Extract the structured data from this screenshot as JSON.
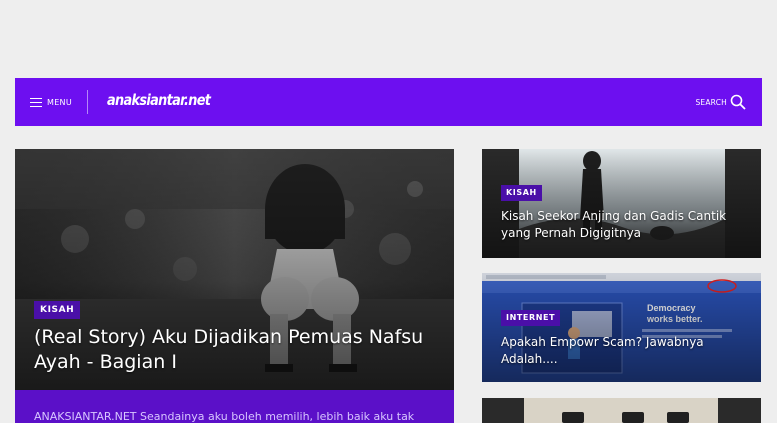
{
  "header": {
    "menu_label": "MENU",
    "logo_text": "anaksiantar.net",
    "search_label": "SEARCH"
  },
  "featured": {
    "tag": "KISAH",
    "title": "(Real Story) Aku Dijadikan Pemuas Nafsu Ayah - Bagian I",
    "excerpt": "ANAKSIANTAR.NET Seandainya aku boleh memilih, lebih baik aku tak"
  },
  "side_posts": [
    {
      "tag": "KISAH",
      "title": "Kisah Seekor Anjing dan Gadis Cantik yang Pernah Digigitnya"
    },
    {
      "tag": "INTERNET",
      "title": "Apakah Empowr Scam? Jawabnya Adalah...."
    },
    {
      "tag": "",
      "title": ""
    }
  ],
  "colors": {
    "brand": "#6d0ff0",
    "tag": "#4a0fa8",
    "background": "#eeeeee"
  },
  "icons": {
    "menu": "hamburger-icon",
    "search": "search-icon"
  }
}
